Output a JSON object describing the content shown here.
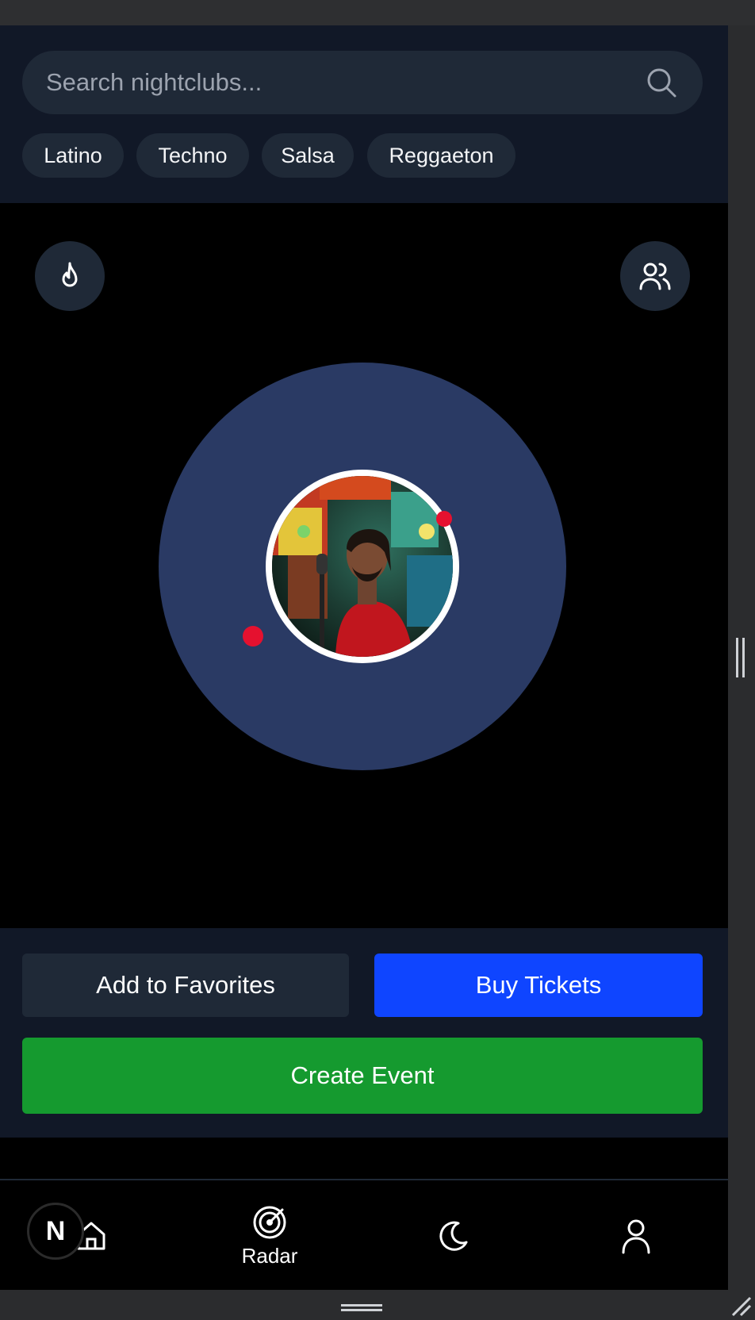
{
  "search": {
    "placeholder": "Search nightclubs..."
  },
  "genres": [
    "Latino",
    "Techno",
    "Salsa",
    "Reggaeton"
  ],
  "radar": {
    "hot_button_icon": "flame-icon",
    "friends_button_icon": "users-icon",
    "center_avatar_icon": "performer-photo"
  },
  "actions": {
    "favorite_label": "Add to Favorites",
    "buy_label": "Buy Tickets",
    "create_label": "Create Event"
  },
  "nav": {
    "items": [
      {
        "icon": "home-icon",
        "label": ""
      },
      {
        "icon": "radar-icon",
        "label": "Radar"
      },
      {
        "icon": "moon-icon",
        "label": ""
      },
      {
        "icon": "user-icon",
        "label": ""
      }
    ],
    "badge_letter": "N"
  },
  "colors": {
    "background": "#000000",
    "surface": "#111827",
    "chip": "#1f2937",
    "radar": "#2a3a64",
    "buy": "#0f45ff",
    "create": "#159a2f",
    "marker": "#e5112f"
  }
}
